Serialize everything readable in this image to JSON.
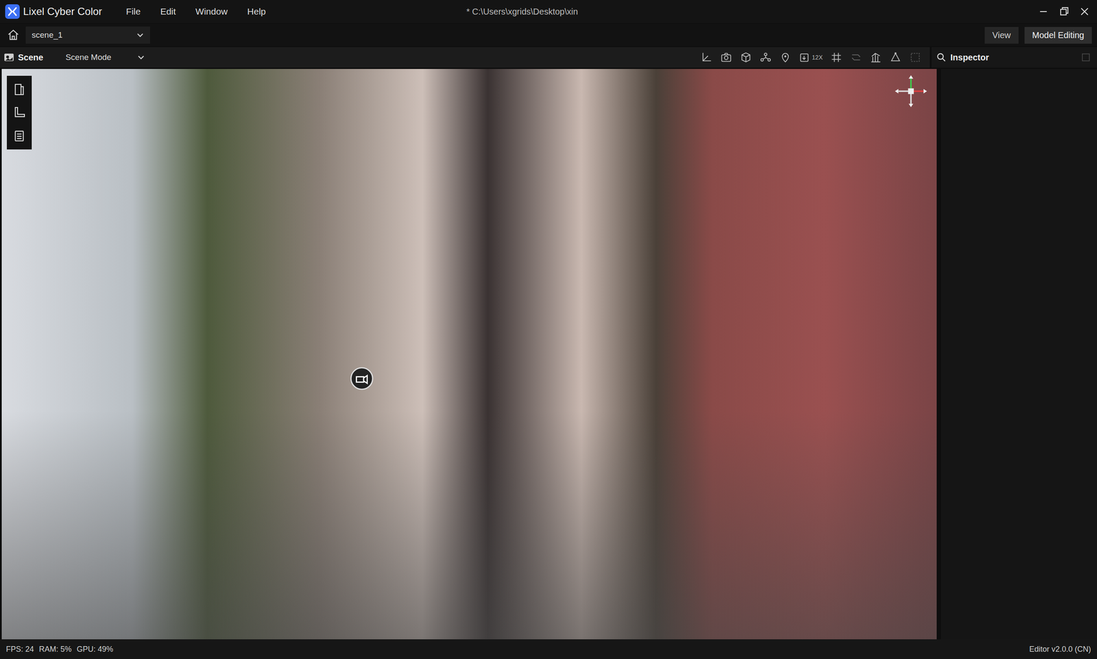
{
  "window": {
    "title": "Lixel Cyber Color",
    "path": "* C:\\Users\\xgrids\\Desktop\\xin"
  },
  "menu": [
    "File",
    "Edit",
    "Window",
    "Help"
  ],
  "scene_selector": {
    "value": "scene_1"
  },
  "mode_buttons": [
    {
      "label": "View",
      "selected": false
    },
    {
      "label": "Model Editing",
      "selected": true
    }
  ],
  "scene_tab": {
    "label": "Scene",
    "mode": "Scene Mode"
  },
  "toolbar": {
    "speed": "12X"
  },
  "inspector": {
    "title": "Inspector"
  },
  "status_bar": {
    "fps": "FPS: 24",
    "ram": "RAM: 5%",
    "gpu": "GPU: 49%",
    "version": "Editor v2.0.0 (CN)"
  }
}
